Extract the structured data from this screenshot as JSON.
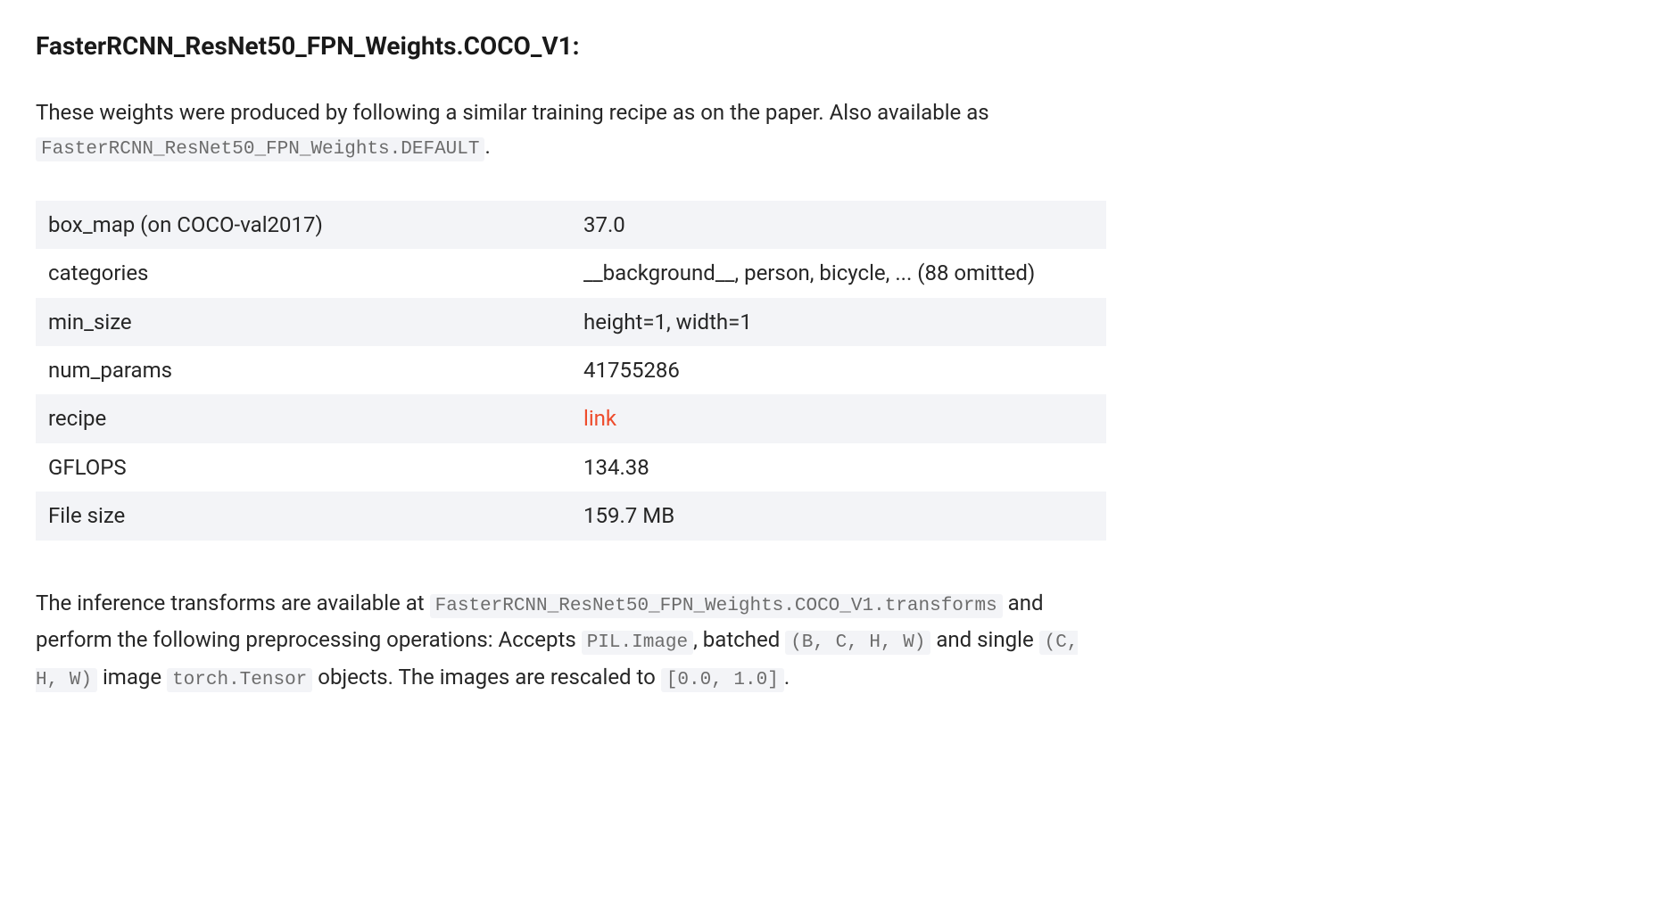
{
  "heading": {
    "title": "FasterRCNN_ResNet50_FPN_Weights.COCO_V1",
    "colon": ":"
  },
  "description": {
    "text_before_code": "These weights were produced by following a similar training recipe as on the paper. Also available as ",
    "code": "FasterRCNN_ResNet50_FPN_Weights.DEFAULT",
    "text_after_code": "."
  },
  "table": {
    "rows": [
      {
        "label": "box_map (on COCO-val2017)",
        "value": "37.0",
        "is_link": false
      },
      {
        "label": "categories",
        "value": "__background__, person, bicycle, ... (88 omitted)",
        "is_link": false
      },
      {
        "label": "min_size",
        "value": "height=1, width=1",
        "is_link": false
      },
      {
        "label": "num_params",
        "value": "41755286",
        "is_link": false
      },
      {
        "label": "recipe",
        "value": "link",
        "is_link": true
      },
      {
        "label": "GFLOPS",
        "value": "134.38",
        "is_link": false
      },
      {
        "label": "File size",
        "value": "159.7 MB",
        "is_link": false
      }
    ]
  },
  "transforms": {
    "p1": "The inference transforms are available at ",
    "c1": "FasterRCNN_ResNet50_FPN_Weights.COCO_V1.transforms",
    "p2": " and perform the following preprocessing operations: Accepts ",
    "c2": "PIL.Image",
    "p3": ", batched ",
    "c3": "(B, C, H, W)",
    "p4": " and single ",
    "c4": "(C, H, W)",
    "p5": " image ",
    "c5": "torch.Tensor",
    "p6": " objects. The images are rescaled to ",
    "c6": "[0.0, 1.0]",
    "p7": "."
  }
}
